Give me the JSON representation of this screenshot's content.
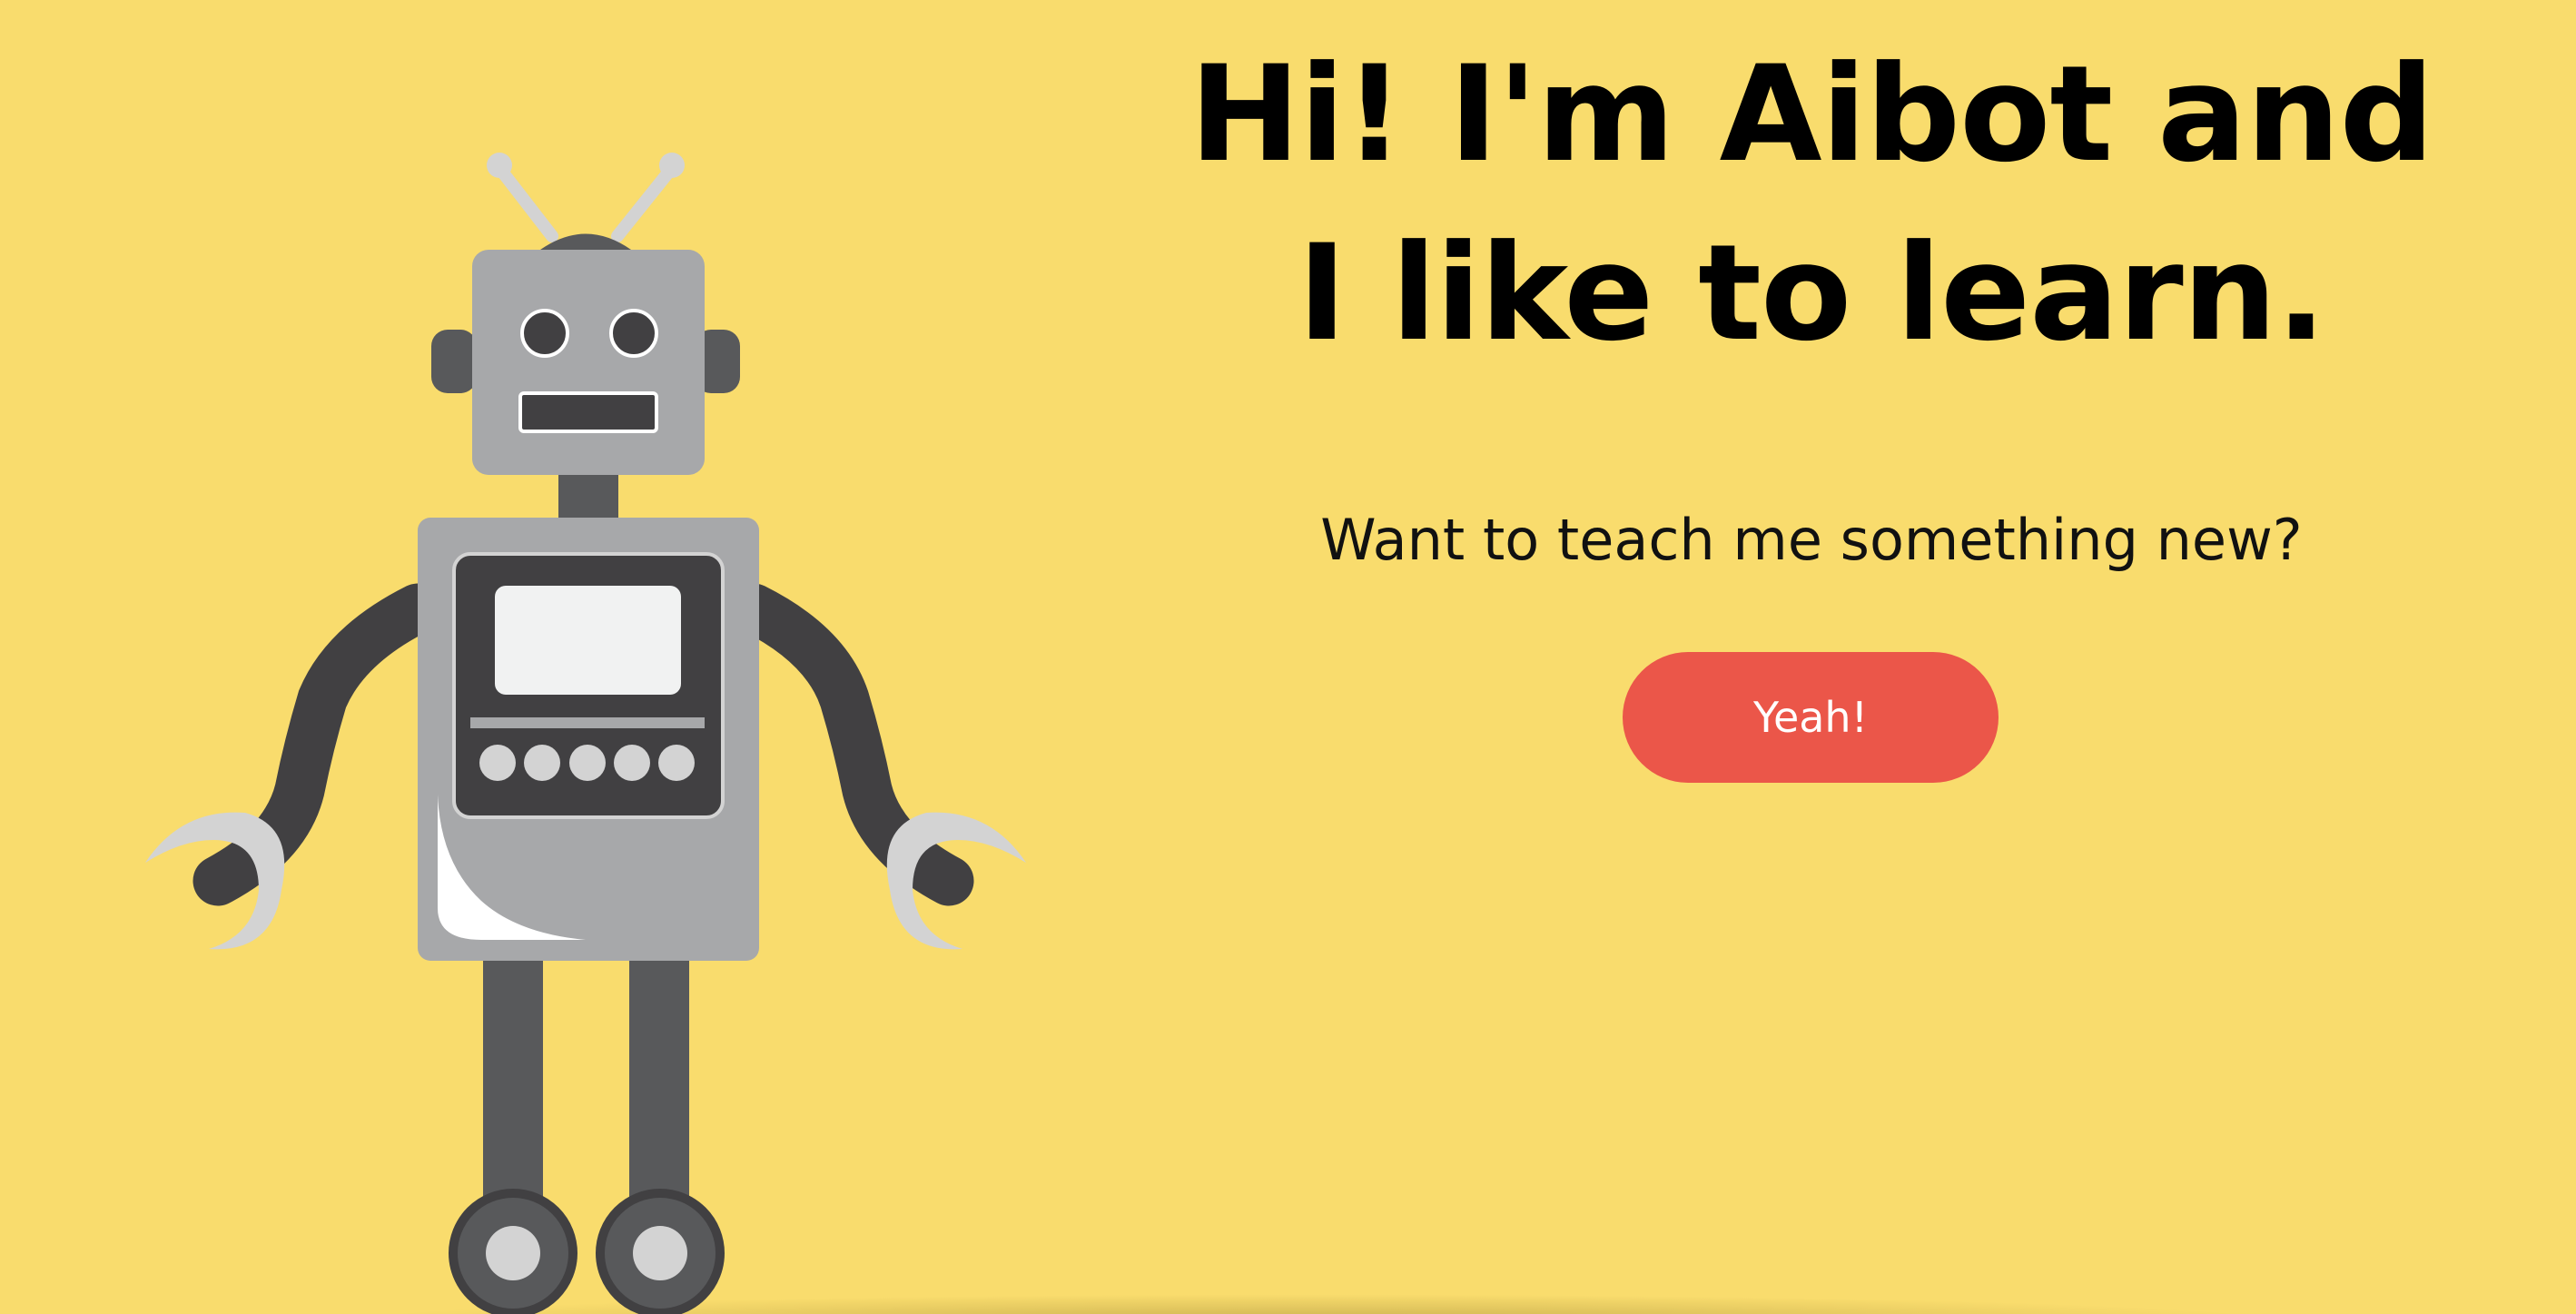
{
  "hero": {
    "headline_line1": "Hi! I'm Aibot and",
    "headline_line2": "I like to learn.",
    "subtitle": "Want to teach me something new?",
    "cta_label": "Yeah!"
  },
  "colors": {
    "background": "#F9DC6D",
    "cta": "#EB5649",
    "robot_body": "#A7A8AA",
    "robot_dark": "#58595B"
  },
  "icons": {
    "mascot": "robot-illustration"
  }
}
